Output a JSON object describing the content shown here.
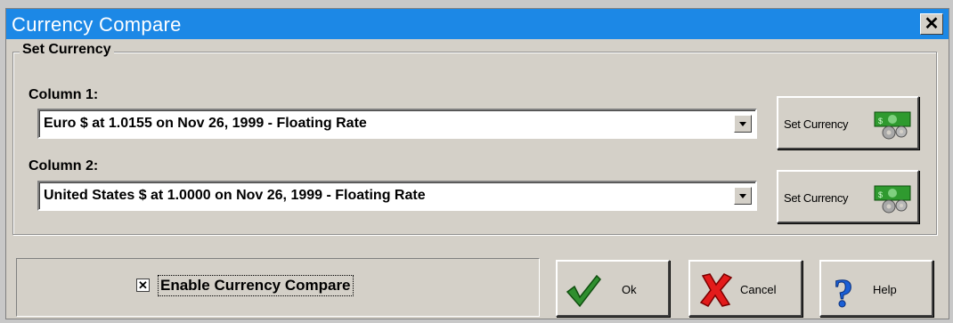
{
  "window": {
    "title": "Currency Compare",
    "close_glyph": "✕",
    "title_bar_color": "#1c88e6"
  },
  "set_currency_group": {
    "label": "Set Currency",
    "column1": {
      "label": "Column 1:",
      "selected": "Euro $ at 1.0155 on Nov 26, 1999 - Floating Rate",
      "button_label": "Set Currency",
      "button_icon": "money-gears-icon"
    },
    "column2": {
      "label": "Column 2:",
      "selected": "United States $ at 1.0000 on Nov 26, 1999 - Floating Rate",
      "button_label": "Set Currency",
      "button_icon": "money-gears-icon"
    }
  },
  "enable_compare": {
    "label": "Enable Currency Compare",
    "checked": true,
    "check_glyph": "✕"
  },
  "buttons": {
    "ok": {
      "label": "Ok",
      "icon": "checkmark-icon"
    },
    "cancel": {
      "label": "Cancel",
      "icon": "x-mark-icon"
    },
    "help": {
      "label": "Help",
      "icon": "question-mark-icon"
    }
  }
}
